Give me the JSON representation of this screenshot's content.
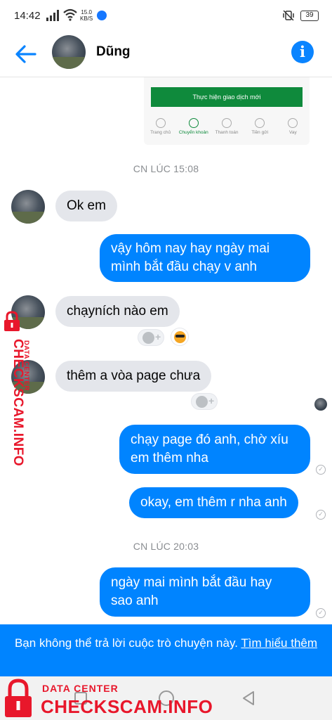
{
  "status_bar": {
    "time": "14:42",
    "speed_value": "15.0",
    "speed_unit": "KB/S",
    "battery": "39"
  },
  "header": {
    "contact_name": "Dũng"
  },
  "shared_image": {
    "button_label": "Thực hiện giao dịch mới",
    "tabs": [
      "Trang chủ",
      "Chuyển khoản",
      "Thanh toán",
      "Tiền gửi",
      "Vay"
    ],
    "accent_color": "#0f8a3c"
  },
  "timestamps": [
    "CN LÚC 15:08",
    "CN LÚC 20:03"
  ],
  "messages": [
    {
      "sender": "contact",
      "text": "Ok em"
    },
    {
      "sender": "me",
      "text": "vậy hôm nay hay ngày mai\nmình bắt đầu chạy v anh"
    },
    {
      "sender": "contact",
      "text": "chạyních nào em"
    },
    {
      "sender": "contact",
      "text": "thêm a vòa page chưa"
    },
    {
      "sender": "me",
      "text": "chạy page đó anh, chờ xíu\nem thêm nha"
    },
    {
      "sender": "me",
      "text": "okay, em thêm r nha anh"
    },
    {
      "sender": "me",
      "text": "ngày mai mình bắt đầu hay\nsao anh"
    }
  ],
  "banner": {
    "text": "Bạn không thể trả lời cuộc trò chuyện này. ",
    "link": "Tìm hiểu thêm"
  },
  "watermark": {
    "small": "DATA CENTER",
    "big": "CHECKSCAM.INFO"
  },
  "colors": {
    "outgoing_bubble": "#0084ff",
    "incoming_bubble": "#e4e6eb",
    "watermark": "#e8172b"
  }
}
